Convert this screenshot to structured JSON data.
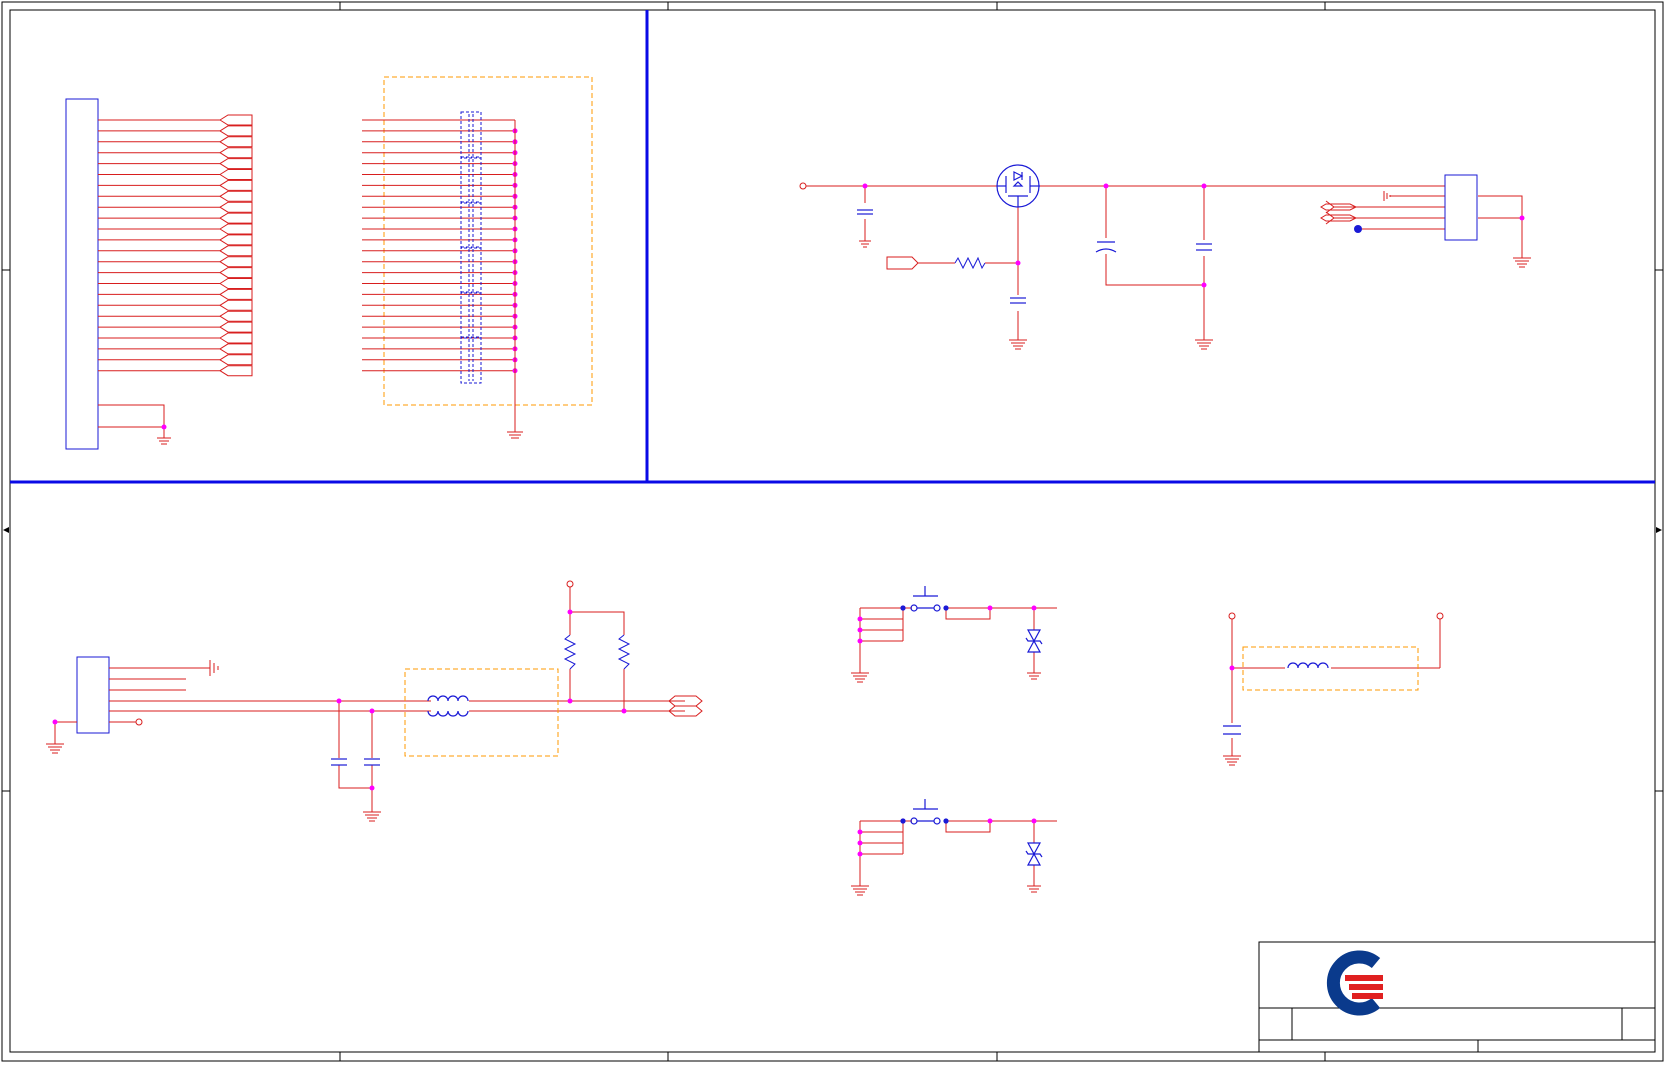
{
  "sheet": {
    "colors": {
      "wire": "#d81e1e",
      "component": "#1a1ad6",
      "junction": "#ff00ff",
      "boundary": "#ff9900",
      "border": "#000000",
      "panel_divider": "#0a0ae6",
      "logo_blue": "#0a3a8c",
      "logo_red": "#e02020"
    },
    "title_block": {
      "logo": "company-logo"
    },
    "off_page_connectors": 4,
    "blocks": [
      {
        "name": "connector-bank-block",
        "description": ""
      },
      {
        "name": "power-switch-block",
        "description": ""
      },
      {
        "name": "differential-filter-block",
        "description": ""
      },
      {
        "name": "push-button-block-1",
        "description": ""
      },
      {
        "name": "push-button-block-2",
        "description": ""
      },
      {
        "name": "inductor-filter-block",
        "description": ""
      }
    ]
  }
}
